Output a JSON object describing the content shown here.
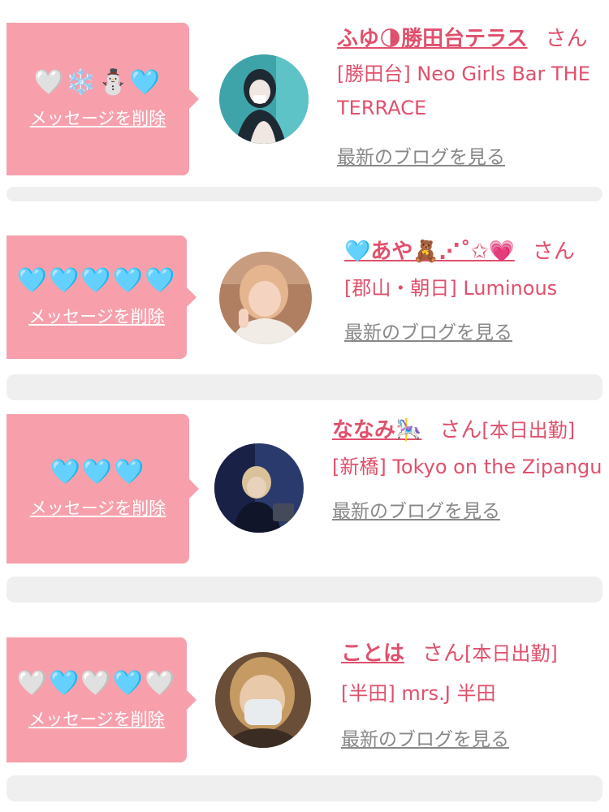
{
  "colors": {
    "accent": "#e0506c",
    "bubble": "#f7a0ac",
    "muted": "#888888",
    "separator": "#efefef"
  },
  "items": [
    {
      "message": "🤍❄️⛄🩵",
      "delete_label": "メッセージを削除",
      "name": "ふゆ🌗勝田台テラス",
      "honorific": "さん",
      "status": "",
      "shop": "[勝田台] Neo Girls Bar THE TERRACE",
      "blog_label": "最新のブログを見る",
      "avatar_colors": [
        "#3fa4a9",
        "#1e2a33",
        "#f1e7e2"
      ]
    },
    {
      "message": "🩵🩵🩵🩵🩵",
      "delete_label": "メッセージを削除",
      "name": "🩵あや🧸⋰˚✩💗",
      "honorific": "さん",
      "status": "",
      "shop": "[郡山・朝日] Luminous",
      "blog_label": "最新のブログを見る",
      "avatar_colors": [
        "#b07f62",
        "#e4b58f",
        "#f4d4c0"
      ]
    },
    {
      "message": "🩵🩵🩵",
      "delete_label": "メッセージを削除",
      "name": "ななみ🎠",
      "honorific": "さん",
      "status": "[本日出勤]",
      "shop": "[新橋] Tokyo on the Zipangu",
      "blog_label": "最新のブログを見る",
      "avatar_colors": [
        "#2b3a6d",
        "#11152a",
        "#d9c29a"
      ]
    },
    {
      "message": "🤍🩵🤍🩵🤍",
      "delete_label": "メッセージを削除",
      "name": "ことは",
      "honorific": "さん",
      "status": "[本日出勤]",
      "shop": "[半田] mrs.J 半田",
      "blog_label": "最新のブログを見る",
      "avatar_colors": [
        "#6a4e37",
        "#c69a63",
        "#e9ecef"
      ]
    }
  ]
}
